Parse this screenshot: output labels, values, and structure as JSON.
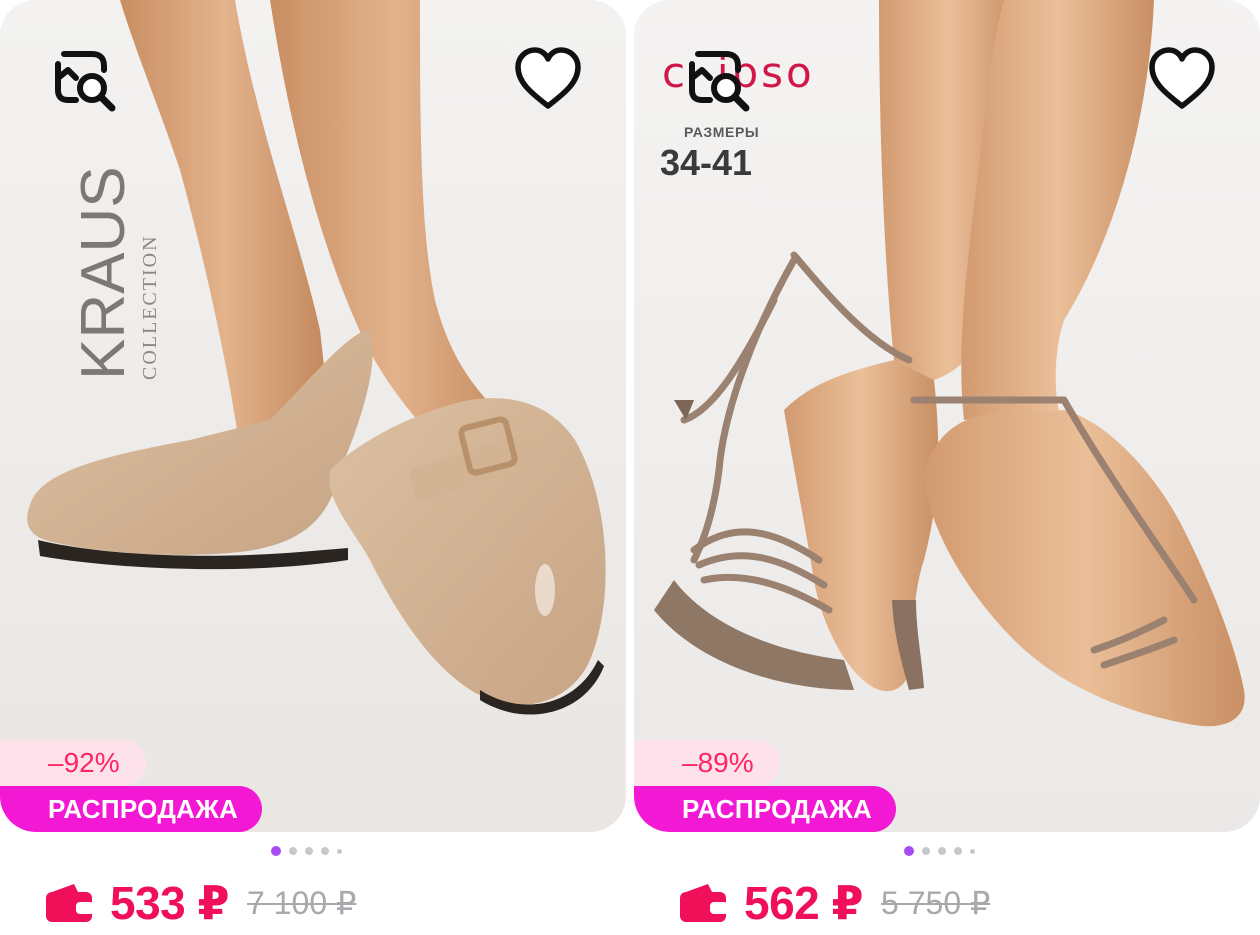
{
  "products": [
    {
      "brand_logo_main": "KRAUS",
      "brand_logo_sub": "COLLECTION",
      "discount": "–92%",
      "sale_badge": "РАСПРОДАЖА",
      "price": "533 ₽",
      "old_price": "7 100 ₽",
      "images_count": 5,
      "active_image": 1
    },
    {
      "brand_logo_main": "ipso",
      "sizes_label": "РАЗМЕРЫ",
      "sizes_value": "34-41",
      "discount": "–89%",
      "sale_badge": "РАСПРОДАЖА",
      "price": "562 ₽",
      "old_price": "5 750 ₽",
      "images_count": 5,
      "active_image": 1
    }
  ],
  "colors": {
    "price": "#f0105a",
    "sale_badge_bg": "#f318d4",
    "discount_bg": "#fde2ec",
    "dot_active": "#a64bf4"
  },
  "icons": [
    "image-search-icon",
    "heart-icon",
    "wallet-icon"
  ]
}
